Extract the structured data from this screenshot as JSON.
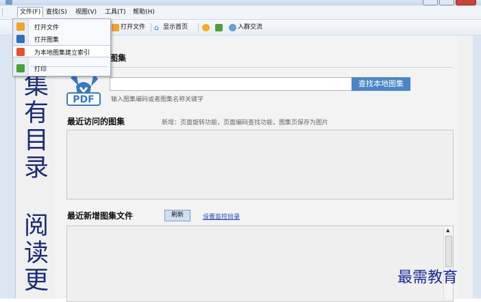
{
  "window": {
    "title": ""
  },
  "menubar": {
    "items": [
      {
        "label": "文件(F)",
        "active": true
      },
      {
        "label": "查找(S)"
      },
      {
        "label": "视图(V)"
      },
      {
        "label": "工具(T)"
      },
      {
        "label": "帮助(H)"
      }
    ]
  },
  "file_menu": {
    "items": [
      {
        "label": "打开文件",
        "icon": "folder-icon"
      },
      {
        "label": "打开图集",
        "icon": "album-icon"
      },
      {
        "label": "为本地图集建立索引",
        "icon": "index-icon"
      },
      {
        "label": "打印",
        "icon": "printer-icon"
      }
    ]
  },
  "toolbar": {
    "open_file": "打开文件",
    "show_home": "显示首页",
    "join_group": "入群交流"
  },
  "side_text": {
    "chars_top": [
      "集",
      "有",
      "目",
      "录"
    ],
    "chars_bottom": [
      "阅",
      "读",
      "更"
    ]
  },
  "search": {
    "title_visible": "图集",
    "input_value": "",
    "hint": "输入图集编码或者图集名称关键字",
    "button": "查找本地图集"
  },
  "recent": {
    "title": "最近访问的图集",
    "note": "新增：页面旋转功能，页面编码查找功能，图集页保存为图片"
  },
  "new_files": {
    "title": "最近新增图集文件",
    "refresh": "刷新",
    "link": "设置监控目录"
  },
  "logo": {
    "text": "PDF"
  },
  "watermark": {
    "text": "最需教育"
  },
  "colors": {
    "accent": "#4a85c8",
    "side_text": "#1a2a78",
    "link": "#1c3db5"
  }
}
